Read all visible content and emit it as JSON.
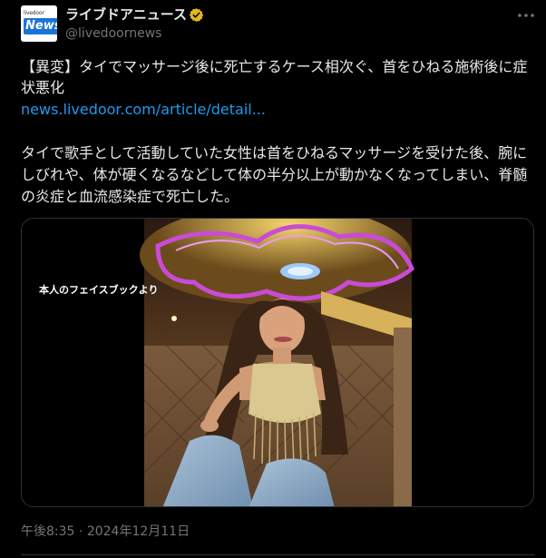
{
  "account": {
    "display_name": "ライブドアニュース",
    "handle": "@livedoornews",
    "avatar_text_small": "livedoor",
    "avatar_text_news": "News",
    "verified_icon": "verified-badge-gold"
  },
  "tweet": {
    "headline": "【異変】タイでマッサージ後に死亡するケース相次ぐ、首をひねる施術後に症状悪化",
    "link_text": "news.livedoor.com/article/detail...",
    "body": "タイで歌手として活動していた女性は首をひねるマッサージを受けた後、腕にしびれや、体が硬くなるなどして体の半分以上が動かなくなってしまい、脊髄の炎症と血流感染症で死亡した。",
    "media_caption": "本人のフェイスブックより",
    "time": "午後8:35",
    "separator": "·",
    "date": "2024年12月11日"
  },
  "icons": {
    "more": "more-options-icon",
    "verified": "verified-badge-icon"
  },
  "colors": {
    "background": "#000000",
    "text": "#e7e9ea",
    "secondary": "#71767b",
    "link": "#1d9bf0",
    "verified": "#e2b719",
    "border": "#2f3336"
  }
}
